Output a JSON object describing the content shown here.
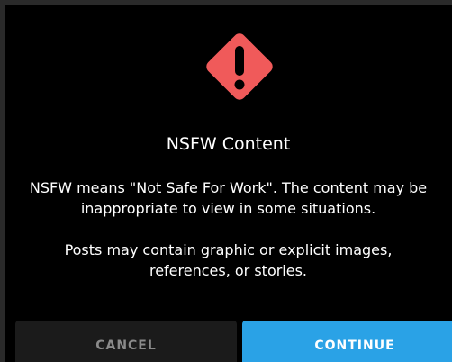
{
  "dialog": {
    "title": "NSFW Content",
    "description_1": "NSFW means \"Not Safe For Work\". The content may be inappropriate to view in some situations.",
    "description_2": "Posts may contain graphic or explicit images, references, or stories.",
    "icon": "warning-diamond-icon"
  },
  "buttons": {
    "cancel_label": "CANCEL",
    "continue_label": "CONTINUE"
  },
  "colors": {
    "background": "#000000",
    "warning": "#f05a5a",
    "accent": "#2aa2e6",
    "cancel_bg": "#1b1b1b"
  }
}
